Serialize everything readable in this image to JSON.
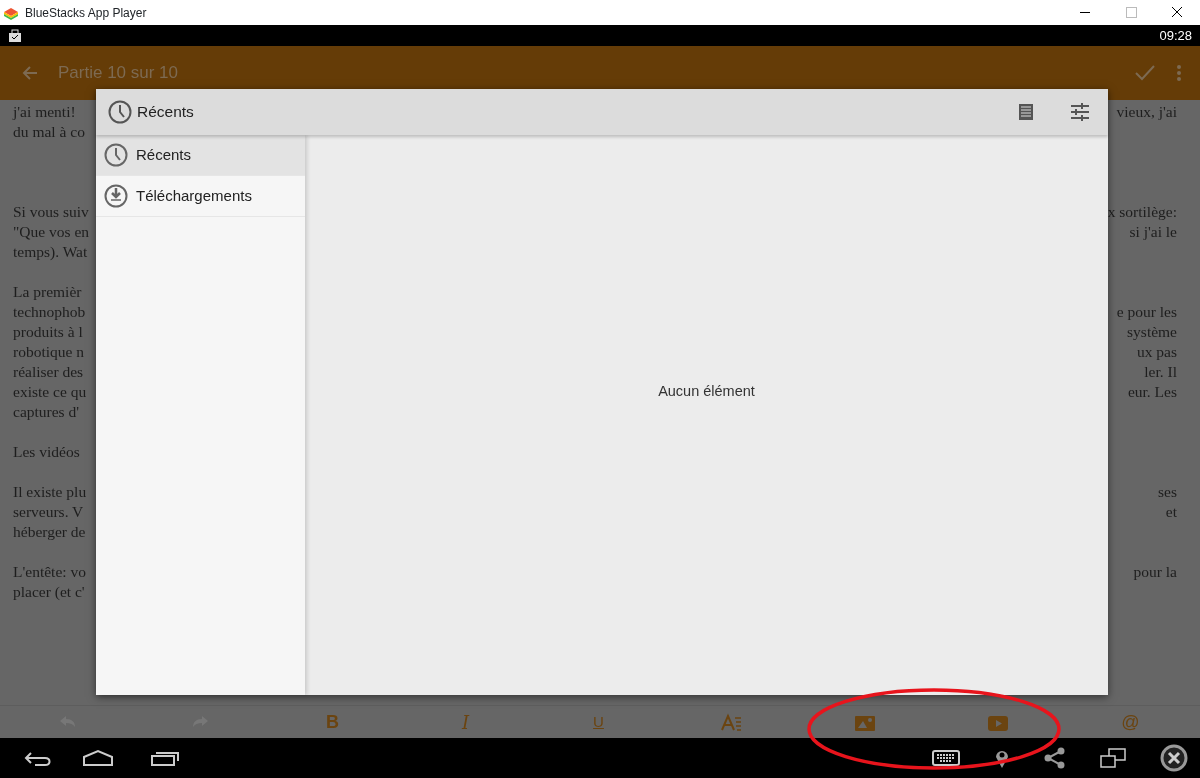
{
  "window": {
    "title": "BlueStacks App Player"
  },
  "status_bar": {
    "time": "09:28"
  },
  "app_bar": {
    "title": "Partie 10 sur 10"
  },
  "document": {
    "paragraphs": [
      {
        "lines": [
          {
            "left": "j'ai menti!",
            "right": "vieux, j'ai"
          },
          {
            "left": "du mal à co"
          }
        ]
      },
      {
        "lines": [
          {
            "left": "Si vous suiv",
            "right": "x sortilège:"
          },
          {
            "left": "\"Que vos en",
            "right": "si j'ai le"
          },
          {
            "left": "temps). Wat"
          }
        ]
      },
      {
        "lines": [
          {
            "left": "La premièr"
          },
          {
            "left": "technophob",
            "right": "e pour les"
          },
          {
            "left": "produits à l",
            "right": "système"
          },
          {
            "left": "robotique n",
            "right": "ux pas"
          },
          {
            "left": "réaliser des",
            "right": "ler. Il"
          },
          {
            "left": "existe ce qu",
            "right": "eur. Les"
          },
          {
            "left": "captures d'"
          }
        ]
      },
      {
        "lines": [
          {
            "left": "Les vidéos"
          }
        ]
      },
      {
        "lines": [
          {
            "left": "Il existe plu",
            "right": "ses"
          },
          {
            "left": "serveurs. V",
            "right": "et"
          },
          {
            "left": "héberger de"
          }
        ]
      },
      {
        "lines": [
          {
            "left": "L'entête: vo",
            "right": "pour la"
          },
          {
            "left": "placer (et c'"
          }
        ]
      }
    ]
  },
  "dialog": {
    "title": "Récents",
    "sidebar": [
      {
        "label": "Récents",
        "kind": "clock",
        "selected": true
      },
      {
        "label": "Téléchargements",
        "kind": "download",
        "selected": false
      }
    ],
    "empty_message": "Aucun élément"
  },
  "format_toolbar": [
    {
      "kind": "undo",
      "disabled": true
    },
    {
      "kind": "redo",
      "disabled": true
    },
    {
      "kind": "bold",
      "label": "B",
      "disabled": false
    },
    {
      "kind": "italic",
      "label": "I",
      "disabled": false
    },
    {
      "kind": "underline",
      "label": "U",
      "disabled": false
    },
    {
      "kind": "text-style",
      "disabled": false
    },
    {
      "kind": "image",
      "disabled": false
    },
    {
      "kind": "video",
      "disabled": false
    },
    {
      "kind": "mention",
      "label": "@",
      "disabled": false
    }
  ]
}
